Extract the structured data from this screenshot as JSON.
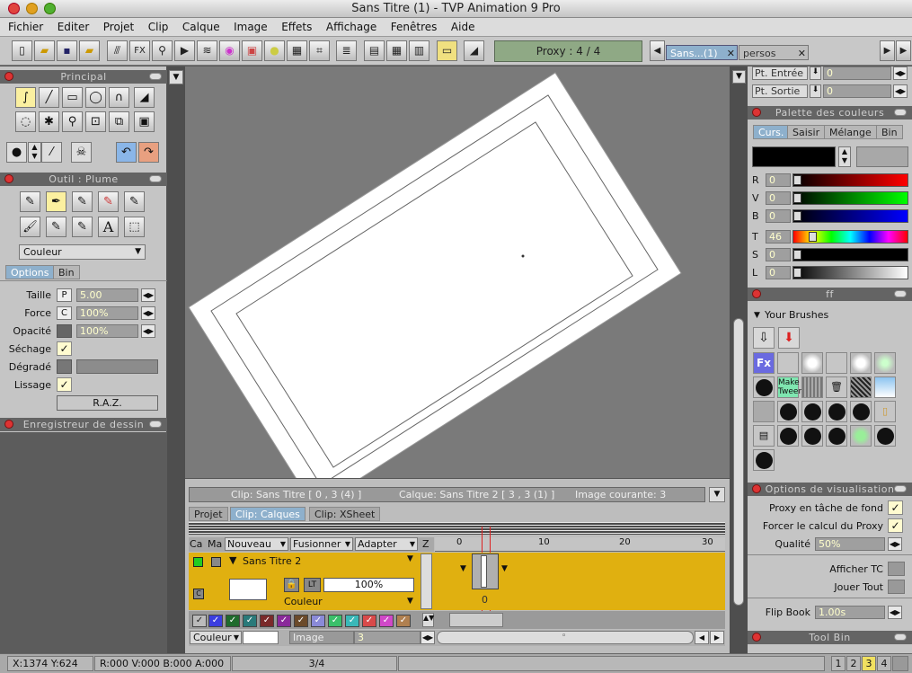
{
  "window": {
    "title": "Sans Titre (1) - TVP Animation 9 Pro"
  },
  "menu": [
    "Fichier",
    "Editer",
    "Projet",
    "Clip",
    "Calque",
    "Image",
    "Effets",
    "Affichage",
    "Fenêtres",
    "Aide"
  ],
  "toolbar": {
    "proxy": "Proxy : 4 / 4",
    "tab_active": "Sans...(1)",
    "tab_other": "persos",
    "fx": "FX"
  },
  "principal": {
    "title": "Principal"
  },
  "outil": {
    "title": "Outil : Plume",
    "mode_select": "Couleur",
    "tabs": [
      "Options",
      "Bin"
    ],
    "taille_label": "Taille",
    "taille_mode": "P",
    "taille_value": "5.00",
    "force_label": "Force",
    "force_mode": "C",
    "force_value": "100%",
    "opacite_label": "Opacité",
    "opacite_value": "100%",
    "sechage_label": "Séchage",
    "degrade_label": "Dégradé",
    "lissage_label": "Lissage",
    "raz": "R.A.Z."
  },
  "recorder": {
    "title": "Enregistreur de dessin"
  },
  "points": {
    "entree_label": "Pt. Entrée",
    "entree_value": "0",
    "sortie_label": "Pt. Sortie",
    "sortie_value": "0"
  },
  "palette": {
    "title": "Palette des couleurs",
    "tabs": [
      "Curs.",
      "Saisir",
      "Mélange",
      "Bin"
    ],
    "channels": [
      {
        "label": "R",
        "value": "0"
      },
      {
        "label": "V",
        "value": "0"
      },
      {
        "label": "B",
        "value": "0"
      },
      {
        "label": "T",
        "value": "46"
      },
      {
        "label": "S",
        "value": "0"
      },
      {
        "label": "L",
        "value": "0"
      }
    ]
  },
  "brushes": {
    "title": "ff",
    "section": "Your Brushes",
    "fx": "Fx",
    "make_tween": "Make Tween"
  },
  "view_options": {
    "title": "Options de visualisation",
    "proxy_bg": "Proxy en tâche de fond",
    "force_proxy": "Forcer le calcul du Proxy",
    "qualite_label": "Qualité",
    "qualite_value": "50%",
    "afficher_tc": "Afficher TC",
    "jouer_tout": "Jouer Tout",
    "flipbook_label": "Flip Book",
    "flipbook_value": "1.00s"
  },
  "toolbin": {
    "title": "Tool Bin"
  },
  "timeline": {
    "info_clip": "Clip: Sans Titre [ 0 , 3  (4) ]",
    "info_layer": "Calque: Sans Titre 2 [ 3 , 3  (1) ]",
    "info_image": "Image courante: 3",
    "tabs": [
      "Projet",
      "Clip: Calques",
      "Clip: XSheet"
    ],
    "col_ca": "Ca",
    "col_ma": "Ma",
    "col_nouveau": "Nouveau",
    "col_fusionner": "Fusionner",
    "col_adapter": "Adapter",
    "col_z": "Z",
    "ticks": [
      "0",
      "10",
      "20",
      "30"
    ],
    "layer_name": "Sans Titre 2",
    "layer_lt": "LT",
    "layer_opacity": "100%",
    "layer_mode": "Couleur",
    "c_badge": "C",
    "frame_label": "0",
    "bottom_mode": "Couleur",
    "image_label": "Image",
    "image_value": "3"
  },
  "status": {
    "coords": "X:1374  Y:624",
    "rgba": "R:000 V:000 B:000 A:000",
    "frame": "3/4",
    "pages": [
      "1",
      "2",
      "3",
      "4"
    ],
    "active_page": "3"
  },
  "colors": {
    "timeline_layer": "#e0b010",
    "accent_tab": "#8eb0cc",
    "canvas_bg": "#7a7a7a"
  }
}
